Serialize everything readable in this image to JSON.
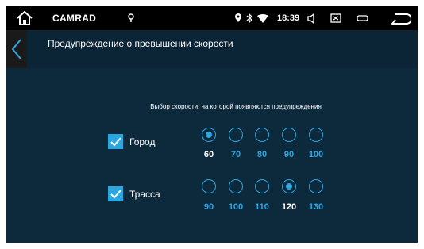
{
  "status_bar": {
    "brand": "CAMRAD",
    "time": "18:39",
    "icons": [
      "home-icon",
      "location-icon",
      "pin-icon",
      "bluetooth-icon",
      "wifi-icon",
      "volume-icon",
      "screen-icon",
      "power-icon",
      "back-arrow-icon"
    ]
  },
  "header": {
    "title": "Предупреждение о превышении скорости"
  },
  "prompt": "Выбор скорости, на которой появляются предупреждения",
  "colors": {
    "accent": "#2aa7e1",
    "background": "#0d2a3d",
    "status_bar": "#000000"
  },
  "rows": [
    {
      "label": "Город",
      "checked": true,
      "speeds": [
        "60",
        "70",
        "80",
        "90",
        "100"
      ],
      "selected_index": 0
    },
    {
      "label": "Трасса",
      "checked": true,
      "speeds": [
        "90",
        "100",
        "110",
        "120",
        "130"
      ],
      "selected_index": 3
    }
  ]
}
